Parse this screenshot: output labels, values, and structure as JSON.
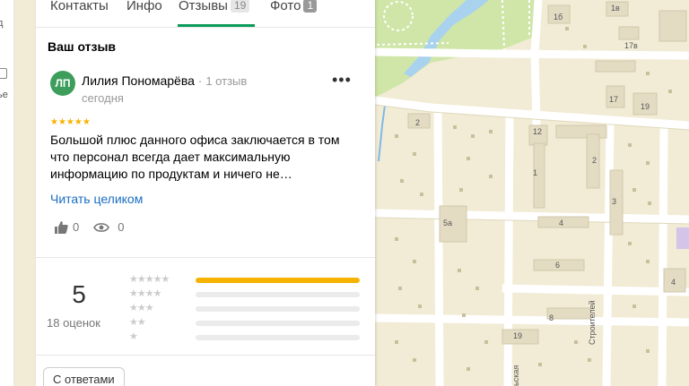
{
  "sidebar_fragments": [
    "д",
    "ье"
  ],
  "tabs": [
    {
      "label": "Контакты"
    },
    {
      "label": "Инфо"
    },
    {
      "label": "Отзывы",
      "count": "19",
      "active": true
    },
    {
      "label": "Фото",
      "count": "1"
    }
  ],
  "review": {
    "section_title": "Ваш отзыв",
    "avatar_initials": "ЛП",
    "author": "Лилия Пономарёва",
    "separator": "·",
    "author_reviews": "1 отзыв",
    "date": "сегодня",
    "more_icon": "more-dots-icon",
    "rating_stars": "★★★★★",
    "text": "Большой плюс данного офиса заключается в том что персонал всегда дает максимальную информацию по продуктам и ничего не…",
    "read_more": "Читать целиком",
    "likes": "0",
    "views": "0"
  },
  "rating": {
    "score": "5",
    "count_label": "18 оценок",
    "rows": [
      {
        "stars": "★★★★★",
        "fraction": 1.0
      },
      {
        "stars": "★★★★",
        "fraction": 0
      },
      {
        "stars": "★★★",
        "fraction": 0
      },
      {
        "stars": "★★",
        "fraction": 0
      },
      {
        "stars": "★",
        "fraction": 0
      }
    ]
  },
  "filter_chip": "С ответами",
  "map": {
    "street_1": "Строителей",
    "street_2": "ьская",
    "building_numbers": [
      "1б",
      "1в",
      "17в",
      "17",
      "19",
      "2",
      "12",
      "1",
      "2",
      "3",
      "4",
      "5а",
      "6",
      "8",
      "19",
      "4"
    ],
    "colors": {
      "land": "#f2ecd6",
      "park": "#cfe6a8",
      "water": "#a9d2ef",
      "road": "#ffffff",
      "building": "#e3dcc3",
      "accent": "#0c9c5a",
      "star": "#f6b200",
      "link": "#1a6ec1"
    }
  }
}
